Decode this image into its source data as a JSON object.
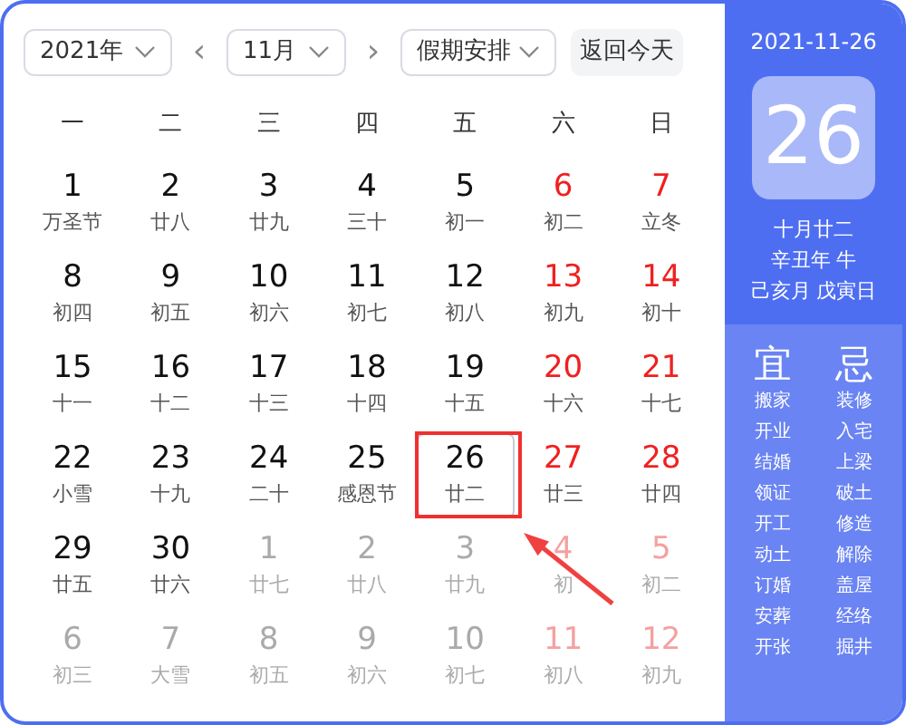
{
  "toolbar": {
    "year": "2021年",
    "month": "11月",
    "holiday": "假期安排",
    "today_button": "返回今天",
    "prev": "‹",
    "next": "›"
  },
  "weekdays": [
    "一",
    "二",
    "三",
    "四",
    "五",
    "六",
    "日"
  ],
  "days": [
    {
      "day": "1",
      "sub": "万圣节",
      "current": true,
      "selected": false
    },
    {
      "day": "2",
      "sub": "廿八",
      "current": true,
      "selected": false
    },
    {
      "day": "3",
      "sub": "廿九",
      "current": true,
      "selected": false
    },
    {
      "day": "4",
      "sub": "三十",
      "current": true,
      "selected": false
    },
    {
      "day": "5",
      "sub": "初一",
      "current": true,
      "selected": false
    },
    {
      "day": "6",
      "sub": "初二",
      "current": true,
      "selected": false
    },
    {
      "day": "7",
      "sub": "立冬",
      "current": true,
      "selected": false
    },
    {
      "day": "8",
      "sub": "初四",
      "current": true,
      "selected": false
    },
    {
      "day": "9",
      "sub": "初五",
      "current": true,
      "selected": false
    },
    {
      "day": "10",
      "sub": "初六",
      "current": true,
      "selected": false
    },
    {
      "day": "11",
      "sub": "初七",
      "current": true,
      "selected": false
    },
    {
      "day": "12",
      "sub": "初八",
      "current": true,
      "selected": false
    },
    {
      "day": "13",
      "sub": "初九",
      "current": true,
      "selected": false
    },
    {
      "day": "14",
      "sub": "初十",
      "current": true,
      "selected": false
    },
    {
      "day": "15",
      "sub": "十一",
      "current": true,
      "selected": false
    },
    {
      "day": "16",
      "sub": "十二",
      "current": true,
      "selected": false
    },
    {
      "day": "17",
      "sub": "十三",
      "current": true,
      "selected": false
    },
    {
      "day": "18",
      "sub": "十四",
      "current": true,
      "selected": false
    },
    {
      "day": "19",
      "sub": "十五",
      "current": true,
      "selected": false
    },
    {
      "day": "20",
      "sub": "十六",
      "current": true,
      "selected": false
    },
    {
      "day": "21",
      "sub": "十七",
      "current": true,
      "selected": false
    },
    {
      "day": "22",
      "sub": "小雪",
      "current": true,
      "selected": false
    },
    {
      "day": "23",
      "sub": "十九",
      "current": true,
      "selected": false
    },
    {
      "day": "24",
      "sub": "二十",
      "current": true,
      "selected": false
    },
    {
      "day": "25",
      "sub": "感恩节",
      "current": true,
      "selected": false
    },
    {
      "day": "26",
      "sub": "廿二",
      "current": true,
      "selected": true
    },
    {
      "day": "27",
      "sub": "廿三",
      "current": true,
      "selected": false
    },
    {
      "day": "28",
      "sub": "廿四",
      "current": true,
      "selected": false
    },
    {
      "day": "29",
      "sub": "廿五",
      "current": true,
      "selected": false
    },
    {
      "day": "30",
      "sub": "廿六",
      "current": true,
      "selected": false
    },
    {
      "day": "1",
      "sub": "廿七",
      "current": false,
      "selected": false
    },
    {
      "day": "2",
      "sub": "廿八",
      "current": false,
      "selected": false
    },
    {
      "day": "3",
      "sub": "廿九",
      "current": false,
      "selected": false
    },
    {
      "day": "4",
      "sub": "初",
      "current": false,
      "selected": false
    },
    {
      "day": "5",
      "sub": "初二",
      "current": false,
      "selected": false
    },
    {
      "day": "6",
      "sub": "初三",
      "current": false,
      "selected": false
    },
    {
      "day": "7",
      "sub": "大雪",
      "current": false,
      "selected": false
    },
    {
      "day": "8",
      "sub": "初五",
      "current": false,
      "selected": false
    },
    {
      "day": "9",
      "sub": "初六",
      "current": false,
      "selected": false
    },
    {
      "day": "10",
      "sub": "初七",
      "current": false,
      "selected": false
    },
    {
      "day": "11",
      "sub": "初八",
      "current": false,
      "selected": false
    },
    {
      "day": "12",
      "sub": "初九",
      "current": false,
      "selected": false
    }
  ],
  "panel": {
    "date": "2021-11-26",
    "big_day": "26",
    "lunar": [
      "十月廿二",
      "辛丑年 牛",
      "己亥月 戊寅日"
    ],
    "good_title": "宜",
    "bad_title": "忌",
    "good": [
      "搬家",
      "开业",
      "结婚",
      "领证",
      "开工",
      "动土",
      "订婚",
      "安葬",
      "开张"
    ],
    "bad": [
      "装修",
      "入宅",
      "上梁",
      "破土",
      "修造",
      "解除",
      "盖屋",
      "经络",
      "掘井"
    ]
  }
}
